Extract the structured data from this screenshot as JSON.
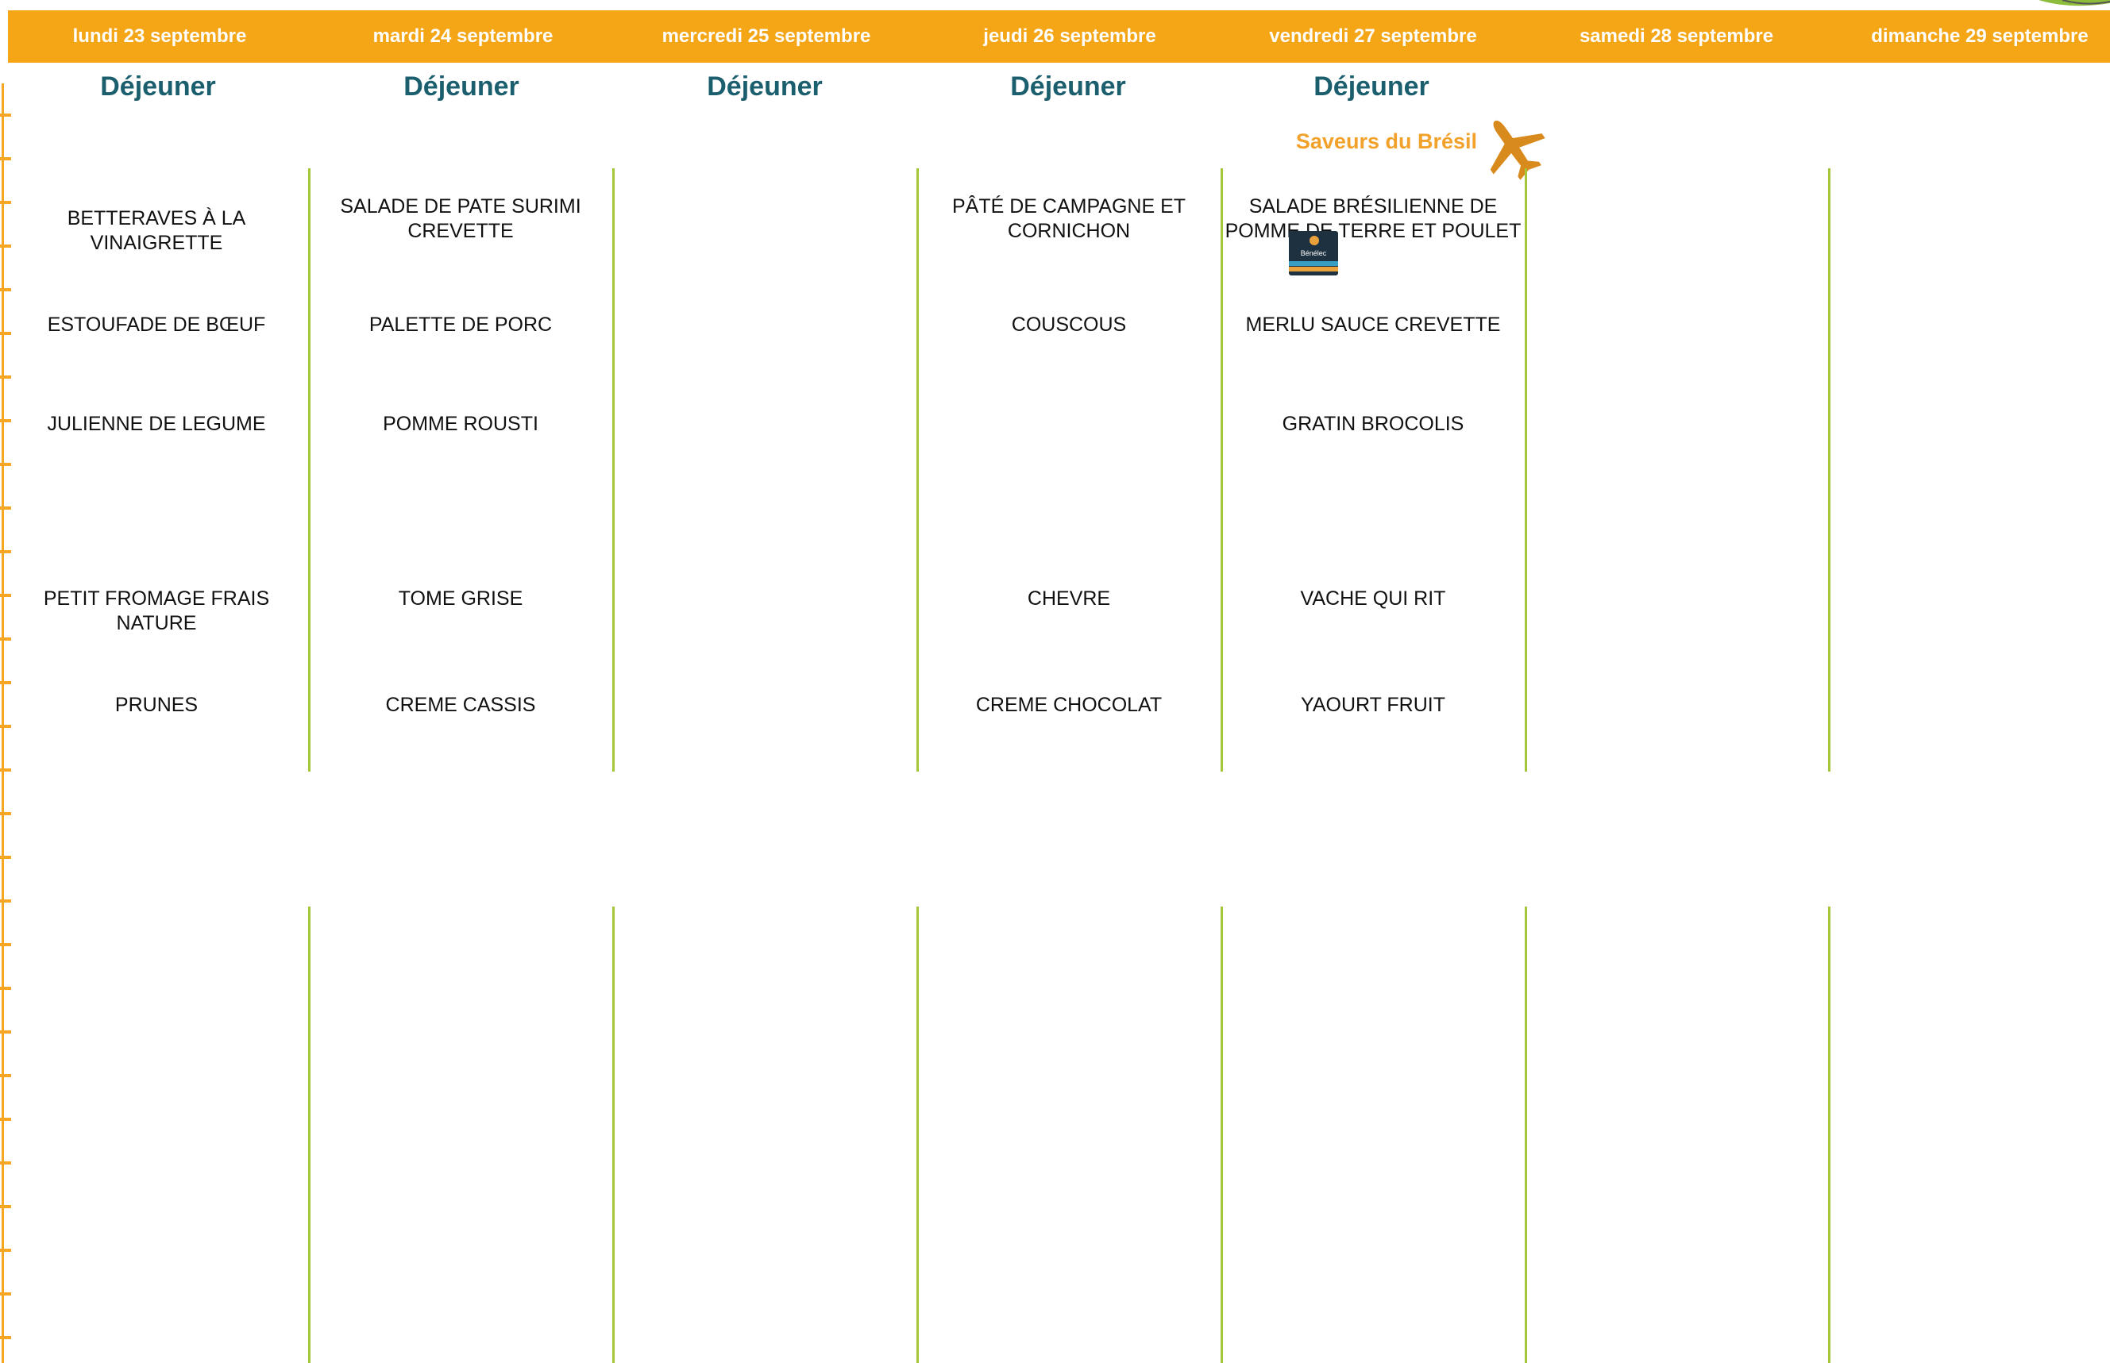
{
  "days": [
    "lundi 23 septembre",
    "mardi 24 septembre",
    "mercredi 25 septembre",
    "jeudi 26 septembre",
    "vendredi 27 septembre",
    "samedi 28 septembre",
    "dimanche 29 septembre"
  ],
  "meal_titles": [
    "Déjeuner",
    "Déjeuner",
    "Déjeuner",
    "Déjeuner",
    "Déjeuner"
  ],
  "theme": {
    "label": "Saveurs du Brésil",
    "icon": "airplane-icon",
    "color": "#f2a22b"
  },
  "badge": {
    "label": "Bénélec",
    "icon": "brand-logo"
  },
  "menu": {
    "monday": {
      "starter": "BETTERAVES À LA VINAIGRETTE",
      "main": "ESTOUFADE DE BŒUF",
      "side": "JULIENNE DE LEGUME",
      "cheese": "PETIT FROMAGE FRAIS NATURE",
      "dessert": "PRUNES"
    },
    "tuesday": {
      "starter": "SALADE DE PATE SURIMI CREVETTE",
      "main": "PALETTE DE PORC",
      "side": "POMME ROUSTI",
      "cheese": "TOME GRISE",
      "dessert": "CREME CASSIS"
    },
    "thursday": {
      "starter": "PÂTÉ DE CAMPAGNE ET CORNICHON",
      "main": "COUSCOUS",
      "cheese": "CHEVRE",
      "dessert": "CREME CHOCOLAT"
    },
    "friday": {
      "starter": "SALADE BRÉSILIENNE DE POMME DE TERRE ET POULET",
      "main": "MERLU SAUCE CREVETTE",
      "side": "GRATIN BROCOLIS",
      "cheese": "VACHE QUI RIT",
      "dessert": "YAOURT FRUIT"
    }
  },
  "colors": {
    "header": "#f5a616",
    "title": "#1b5e6e",
    "divider": "#a6c63a"
  }
}
